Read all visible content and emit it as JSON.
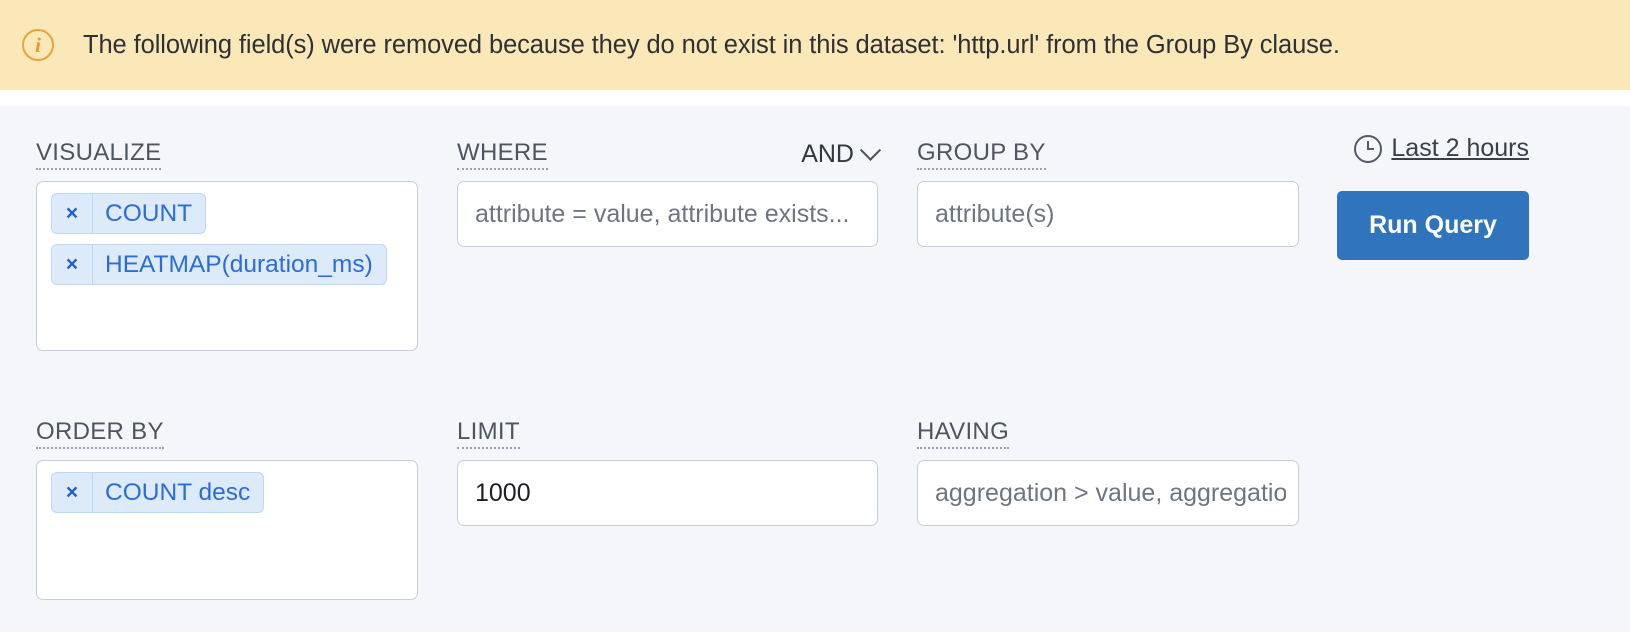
{
  "banner": {
    "icon": "info-circle-icon",
    "message": "The following field(s) were removed because they do not exist in this dataset: 'http.url' from the Group By clause.",
    "background_color": "#fbe8b8",
    "icon_color": "#e09b32"
  },
  "query_builder": {
    "background_color": "#f4f6fa",
    "accent_color": "#2f74bd",
    "chip_color": "#2b6cda",
    "visualize": {
      "label": "VISUALIZE",
      "chips": [
        {
          "remove": "×",
          "text": "COUNT"
        },
        {
          "remove": "×",
          "text": "HEATMAP(duration_ms)"
        }
      ]
    },
    "where": {
      "label": "WHERE",
      "operator": "AND",
      "operator_icon": "chevron-down-icon",
      "placeholder": "attribute = value, attribute exists...",
      "value": ""
    },
    "group_by": {
      "label": "GROUP BY",
      "placeholder": "attribute(s)",
      "value": ""
    },
    "order_by": {
      "label": "ORDER BY",
      "chips": [
        {
          "remove": "×",
          "text": "COUNT desc"
        }
      ]
    },
    "limit": {
      "label": "LIMIT",
      "placeholder": "1000",
      "value": "1000"
    },
    "having": {
      "label": "HAVING",
      "placeholder": "aggregation > value, aggregation exists...",
      "value": ""
    },
    "time_range": {
      "icon": "clock-icon",
      "label": "Last 2 hours"
    },
    "run_query": {
      "label": "Run Query"
    }
  }
}
